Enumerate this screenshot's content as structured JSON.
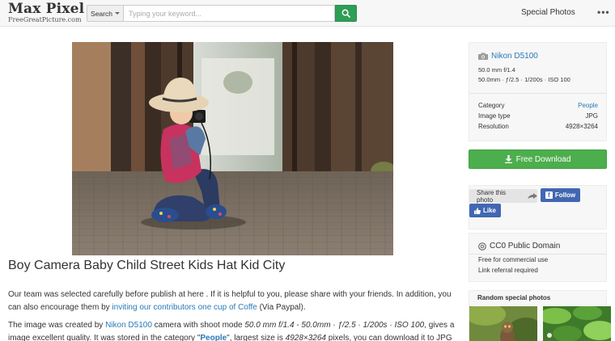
{
  "header": {
    "logo_title": "Max Pixel",
    "logo_subtitle": "FreeGreatPicture.com",
    "search_scope": "Search",
    "search_placeholder": "Typing your keyword...",
    "special_link": "Special Photos",
    "more_label": "•••"
  },
  "main": {
    "title": "Boy Camera Baby Child Street Kids Hat Kid City",
    "para1": {
      "text_a": "Our team was selected carefully before publish at here . If it is helpful to you, please share with your friends. In addition, you can also encourage them by ",
      "link": "inviting our contributors one cup of Coffe",
      "text_b": " (Via Paypal)."
    },
    "para2": {
      "text_a": "The image was created by ",
      "camera_link": "Nikon D5100",
      "text_b": " camera with shoot mode ",
      "shoot_mode": "50.0 mm f/1.4 - 50.0mm · ƒ/2.5 · 1/200s · ISO 100",
      "text_c": ", gives a image excellent quality. It was stored in the category \"",
      "category_link": "People",
      "text_d": "\", largest size is ",
      "size": "4928×3264",
      "text_e": " pixels, you can download it to JPG"
    }
  },
  "sidebar": {
    "camera": {
      "name": "Nikon D5100",
      "lens": "50.0 mm f/1.4",
      "settings": "50.0mm · ƒ/2.5 · 1/200s · ISO 100"
    },
    "info": [
      {
        "label": "Category",
        "value": "People"
      },
      {
        "label": "Image type",
        "value": "JPG"
      },
      {
        "label": "Resolution",
        "value": "4928×3264"
      }
    ],
    "download_label": "Free Download",
    "share": {
      "label": "Share this photo",
      "follow": "Follow",
      "like": "Like"
    },
    "license": {
      "title": "CC0 Public Domain",
      "line1": "Free for commercial use",
      "line2": "Link referral required"
    },
    "random_title": "Random special photos"
  },
  "colors": {
    "accent_green": "#4cae4c",
    "link_blue": "#2a7ab8",
    "facebook_blue": "#4267b2"
  }
}
